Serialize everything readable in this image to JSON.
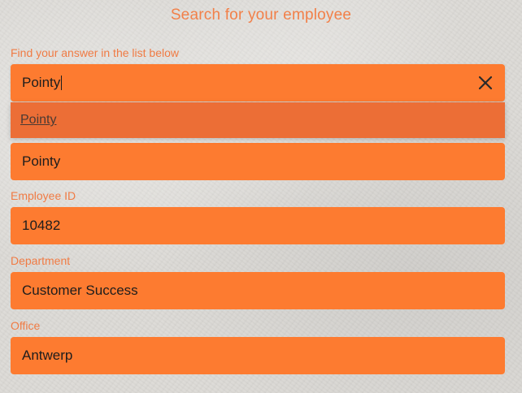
{
  "header": {
    "title": "Search for your employee"
  },
  "search": {
    "label": "Find your answer in the list below",
    "value": "Pointy",
    "clear_icon": "close-icon"
  },
  "dropdown": {
    "options": [
      "Pointy"
    ]
  },
  "fields": {
    "name": {
      "value": "Pointy"
    },
    "employee_id": {
      "label": "Employee ID",
      "value": "10482"
    },
    "department": {
      "label": "Department",
      "value": "Customer Success"
    },
    "office": {
      "label": "Office",
      "value": "Antwerp"
    }
  },
  "colors": {
    "field_background": "#fd7b30",
    "dropdown_background": "#ec6e36",
    "label_text": "#f07b44",
    "title_text": "#f28049"
  }
}
